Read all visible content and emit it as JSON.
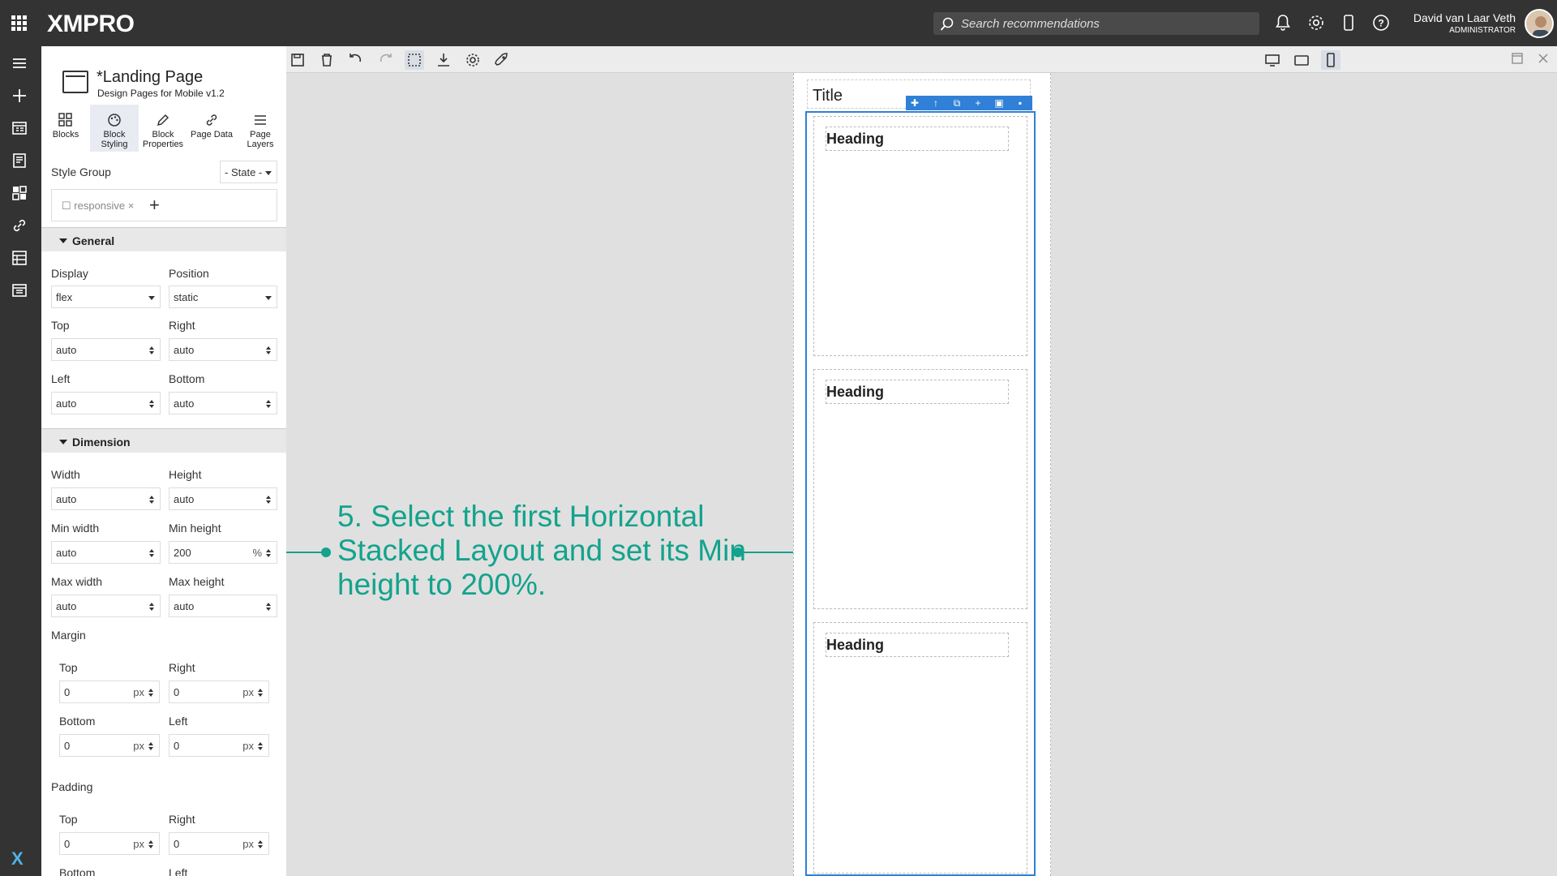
{
  "header": {
    "logo": "XMPRO",
    "search_placeholder": "Search recommendations",
    "user_name": "David van Laar Veth",
    "user_role": "ADMINISTRATOR"
  },
  "page": {
    "title": "*Landing Page",
    "subtitle": "Design Pages for Mobile v1.2"
  },
  "panel_tabs": [
    {
      "label1": "Blocks",
      "label2": ""
    },
    {
      "label1": "Block",
      "label2": "Styling"
    },
    {
      "label1": "Block",
      "label2": "Properties"
    },
    {
      "label1": "Page Data",
      "label2": ""
    },
    {
      "label1": "Page",
      "label2": "Layers"
    }
  ],
  "style_group": {
    "label": "Style Group",
    "state": "- State -",
    "chip": "responsive ×"
  },
  "general": {
    "title": "General",
    "display_label": "Display",
    "display": "flex",
    "position_label": "Position",
    "position": "static",
    "top_label": "Top",
    "top": "auto",
    "right_label": "Right",
    "right": "auto",
    "left_label": "Left",
    "left": "auto",
    "bottom_label": "Bottom",
    "bottom": "auto"
  },
  "dimension": {
    "title": "Dimension",
    "width_label": "Width",
    "width": "auto",
    "height_label": "Height",
    "height": "auto",
    "min_width_label": "Min width",
    "min_width": "auto",
    "min_height_label": "Min height",
    "min_height": "200",
    "min_height_unit": "%",
    "max_width_label": "Max width",
    "max_width": "auto",
    "max_height_label": "Max height",
    "max_height": "auto",
    "margin_label": "Margin",
    "m_top_label": "Top",
    "m_top": "0",
    "m_right_label": "Right",
    "m_right": "0",
    "m_bottom_label": "Bottom",
    "m_bottom": "0",
    "m_left_label": "Left",
    "m_left": "0",
    "padding_label": "Padding",
    "p_top_label": "Top",
    "p_top": "0",
    "p_right_label": "Right",
    "p_right": "0",
    "p_bottom_label": "Bottom",
    "p_left_label": "Left",
    "unit": "px"
  },
  "canvas": {
    "title": "Title",
    "headings": [
      "Heading",
      "Heading",
      "Heading"
    ]
  },
  "annotation": {
    "text": "5. Select the first Horizontal Stacked Layout and set its Min height to 200%."
  }
}
